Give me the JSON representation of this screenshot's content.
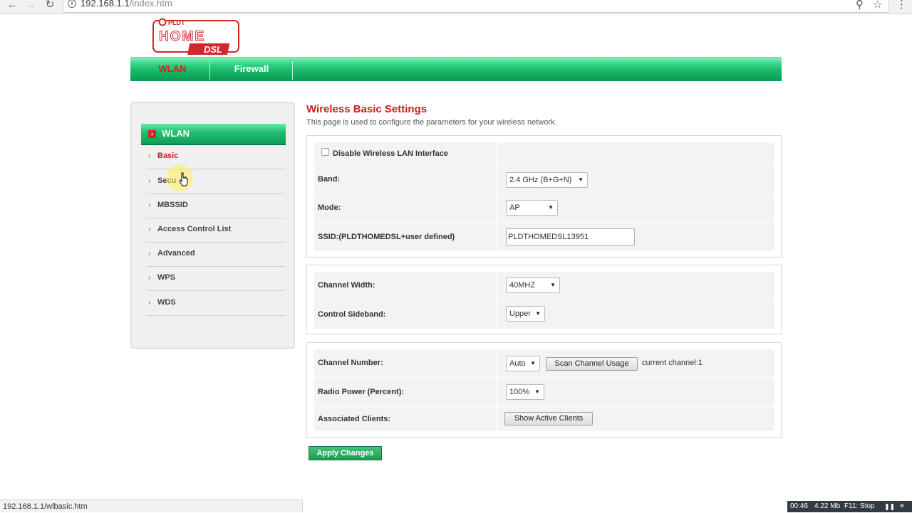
{
  "browser": {
    "url_host": "192.168.1.1",
    "url_path": "/index.htm"
  },
  "logo": {
    "brand_top": "PLDT",
    "brand_main": "HOME",
    "brand_sub": "DSL"
  },
  "topnav": {
    "items": [
      {
        "label": "WLAN"
      },
      {
        "label": "Firewall"
      }
    ]
  },
  "sidebar": {
    "header": "WLAN",
    "items": [
      {
        "label": "Basic"
      },
      {
        "label": "Secu"
      },
      {
        "label": "MBSSID"
      },
      {
        "label": "Access Control List"
      },
      {
        "label": "Advanced"
      },
      {
        "label": "WPS"
      },
      {
        "label": "WDS"
      }
    ]
  },
  "main": {
    "title": "Wireless Basic Settings",
    "description": "This page is used to configure the parameters for your wireless network.",
    "disable_wlan_label": "Disable Wireless LAN Interface",
    "band_label": "Band:",
    "band_value": "2.4 GHz (B+G+N)",
    "mode_label": "Mode:",
    "mode_value": "AP",
    "ssid_label": "SSID:(PLDTHOMEDSL+user defined)",
    "ssid_value": "PLDTHOMEDSL13951",
    "channel_width_label": "Channel Width:",
    "channel_width_value": "40MHZ",
    "control_sideband_label": "Control Sideband:",
    "control_sideband_value": "Upper",
    "channel_number_label": "Channel Number:",
    "channel_number_value": "Auto",
    "scan_button": "Scan Channel Usage",
    "current_channel": "current channel:1",
    "radio_power_label": "Radio Power (Percent):",
    "radio_power_value": "100%",
    "associated_clients_label": "Associated Clients:",
    "show_clients_button": "Show Active Clients",
    "apply_button": "Apply Changes"
  },
  "statusbar": {
    "url": "192.168.1.1/wlbasic.htm"
  },
  "recorder": {
    "time": "00:46",
    "size": "4.22 Mb",
    "stop": "F11: Stop"
  },
  "colors": {
    "accent_red": "#cc1d1d",
    "nav_green": "#14b565"
  }
}
